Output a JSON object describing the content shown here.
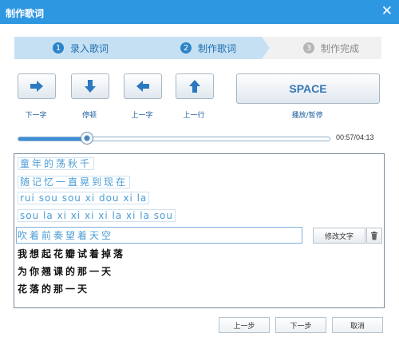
{
  "window": {
    "title": "制作歌词"
  },
  "steps": [
    {
      "num": "1",
      "label": "录入歌词",
      "state": "done"
    },
    {
      "num": "2",
      "label": "制作歌词",
      "state": "active"
    },
    {
      "num": "3",
      "label": "制作完成",
      "state": "pending"
    }
  ],
  "controls": {
    "next_char": "下一字",
    "stop": "停顿",
    "prev_char": "上一字",
    "prev_line": "上一行",
    "space_label": "SPACE",
    "play_pause": "播放/暂停"
  },
  "playback": {
    "time": "00:57/04:13",
    "progress": 0.22
  },
  "lyrics": {
    "done_lines": [
      "童年的荡秋千",
      "随记忆一直晃到现在",
      "rui sou sou xi dou xi la",
      "sou la xi xi xi xi la xi la sou"
    ],
    "current_line": "吹着前奏望着天空",
    "current_highlight_upto": 8,
    "pending_lines": [
      "我想起花瓣试着掉落",
      "为你翘课的那一天",
      "花落的那一天"
    ],
    "edit_label": "修改文字"
  },
  "footer": {
    "prev": "上一步",
    "next": "下一步",
    "cancel": "取消"
  },
  "colors": {
    "titlebar": "#2e97e2",
    "accent": "#3e8fd6",
    "step_active": "#c6e0f3"
  }
}
